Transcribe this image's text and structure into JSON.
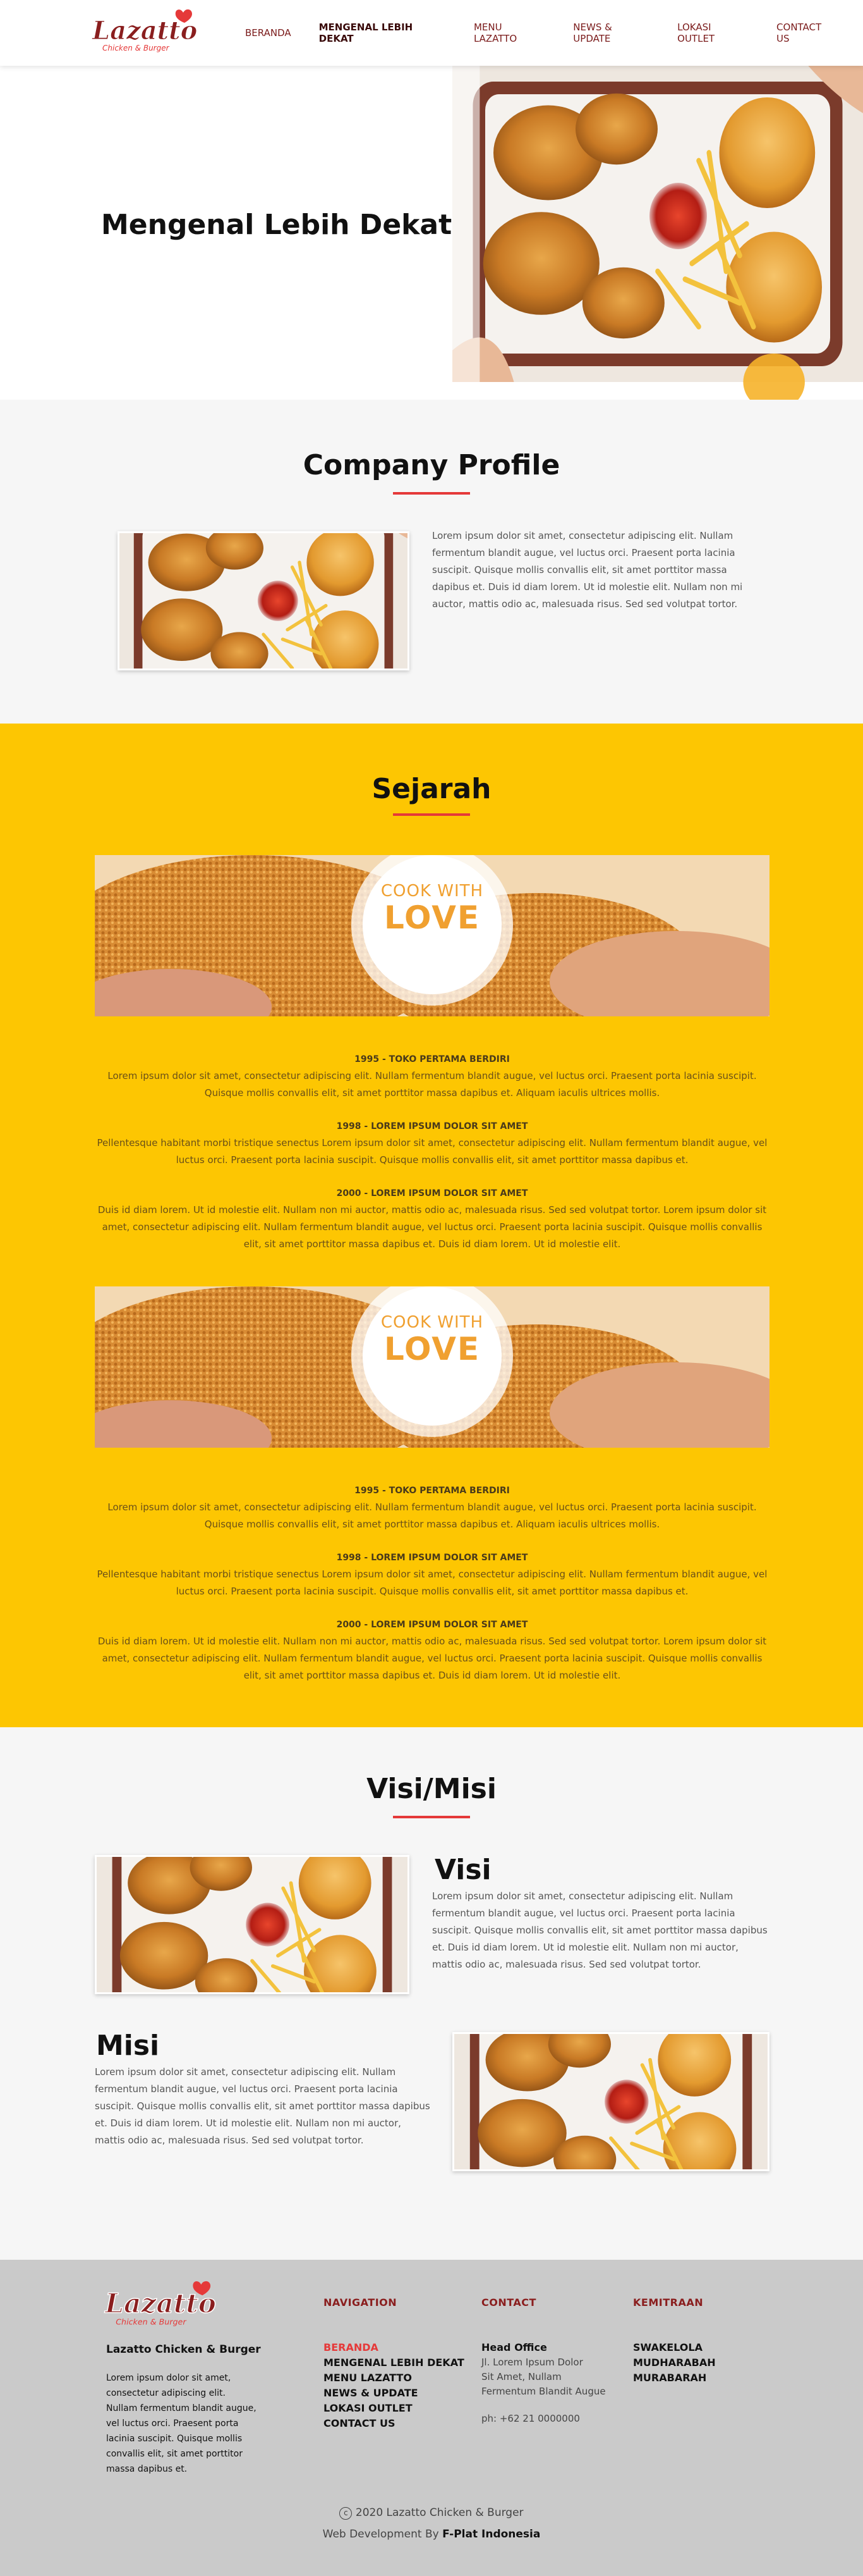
{
  "brand": {
    "logo_text": "Lazatto",
    "logo_sub": "Chicken & Burger"
  },
  "nav": {
    "items": [
      {
        "label": "BERANDA"
      },
      {
        "label": "MENGENAL LEBIH DEKAT"
      },
      {
        "label": "MENU LAZATTO"
      },
      {
        "label": "NEWS & UPDATE"
      },
      {
        "label": "LOKASI OUTLET"
      },
      {
        "label": "CONTACT US"
      }
    ]
  },
  "hero": {
    "title": "Mengenal Lebih Dekat"
  },
  "company_profile": {
    "title": "Company Profile",
    "text": "Lorem ipsum dolor sit amet, consectetur adipiscing elit. Nullam fermentum blandit augue, vel luctus orci. Praesent porta lacinia suscipit. Quisque mollis convallis elit, sit amet porttitor massa dapibus et. Duis id diam lorem. Ut id molestie elit. Nullam non mi auctor, mattis odio ac, malesuada risus. Sed sed volutpat tortor."
  },
  "sejarah": {
    "title": "Sejarah",
    "banner_top": "COOK WITH",
    "banner_big": "LOVE",
    "blocks": [
      {
        "items": [
          {
            "heading": "1995 - TOKO PERTAMA BERDIRI",
            "text": "Lorem ipsum dolor sit amet, consectetur adipiscing elit. Nullam fermentum blandit augue, vel luctus orci. Praesent porta lacinia suscipit. Quisque mollis convallis elit, sit amet porttitor massa dapibus et. Aliquam iaculis ultrices mollis."
          },
          {
            "heading": "1998 - LOREM IPSUM DOLOR SIT AMET",
            "text": "Pellentesque habitant morbi tristique senectus  Lorem ipsum dolor sit amet, consectetur adipiscing elit. Nullam fermentum blandit augue, vel luctus orci. Praesent porta lacinia suscipit. Quisque mollis convallis elit, sit amet porttitor massa dapibus et."
          },
          {
            "heading": "2000 - LOREM IPSUM DOLOR SIT AMET",
            "text": "Duis id diam lorem. Ut id molestie elit. Nullam non mi auctor, mattis odio ac, malesuada risus. Sed sed volutpat tortor. Lorem ipsum dolor sit amet, consectetur adipiscing elit. Nullam fermentum blandit augue, vel luctus orci. Praesent porta lacinia suscipit. Quisque mollis convallis elit, sit amet porttitor massa dapibus et. Duis id diam lorem. Ut id molestie elit."
          }
        ]
      },
      {
        "items": [
          {
            "heading": "1995 - TOKO PERTAMA BERDIRI",
            "text": "Lorem ipsum dolor sit amet, consectetur adipiscing elit. Nullam fermentum blandit augue, vel luctus orci. Praesent porta lacinia suscipit. Quisque mollis convallis elit, sit amet porttitor massa dapibus et. Aliquam iaculis ultrices mollis."
          },
          {
            "heading": "1998 - LOREM IPSUM DOLOR SIT AMET",
            "text": "Pellentesque habitant morbi tristique senectus  Lorem ipsum dolor sit amet, consectetur adipiscing elit. Nullam fermentum blandit augue, vel luctus orci. Praesent porta lacinia suscipit. Quisque mollis convallis elit, sit amet porttitor massa dapibus et."
          },
          {
            "heading": "2000 - LOREM IPSUM DOLOR SIT AMET",
            "text": "Duis id diam lorem. Ut id molestie elit. Nullam non mi auctor, mattis odio ac, malesuada risus. Sed sed volutpat tortor. Lorem ipsum dolor sit amet, consectetur adipiscing elit. Nullam fermentum blandit augue, vel luctus orci. Praesent porta lacinia suscipit. Quisque mollis convallis elit, sit amet porttitor massa dapibus et. Duis id diam lorem. Ut id molestie elit."
          }
        ]
      }
    ]
  },
  "visimisi": {
    "title": "Visi/Misi",
    "visi_title": "Visi",
    "visi_text": "Lorem ipsum dolor sit amet, consectetur adipiscing elit. Nullam fermentum blandit augue, vel luctus orci. Praesent porta lacinia suscipit. Quisque mollis convallis elit, sit amet porttitor massa dapibus et. Duis id diam lorem. Ut id molestie elit. Nullam non mi auctor, mattis odio ac, malesuada risus. Sed sed volutpat tortor.",
    "misi_title": "Misi",
    "misi_text": "Lorem ipsum dolor sit amet, consectetur adipiscing elit. Nullam fermentum blandit augue, vel luctus orci. Praesent porta lacinia suscipit. Quisque mollis convallis elit, sit amet porttitor massa dapibus et. Duis id diam lorem. Ut id molestie elit. Nullam non mi auctor, mattis odio ac, malesuada risus. Sed sed volutpat tortor."
  },
  "footer": {
    "name": "Lazatto Chicken & Burger",
    "desc": "Lorem ipsum dolor sit amet, consectetur adipiscing elit. Nullam fermentum blandit augue, vel luctus orci. Praesent porta lacinia suscipit. Quisque mollis convallis elit, sit amet porttitor massa dapibus et.",
    "nav_heading": "NAVIGATION",
    "nav_links": [
      "BERANDA",
      "MENGENAL LEBIH DEKAT",
      "MENU LAZATTO",
      "NEWS & UPDATE",
      "LOKASI OUTLET",
      "CONTACT US"
    ],
    "contact_heading": "CONTACT",
    "office_title": "Head Office",
    "office_address": [
      "Jl. Lorem Ipsum Dolor",
      "Sit Amet, Nullam",
      "Fermentum Blandit Augue"
    ],
    "phone": "ph: +62 21 0000000",
    "kemitraan_heading": "KEMITRAAN",
    "kemitraan_links": [
      "SWAKELOLA",
      "MUDHARABAH",
      "MURABARAH"
    ],
    "copyright": "2020 Lazatto Chicken & Burger",
    "dev_prefix": "Web Development By",
    "dev_name": "F-Plat Indonesia"
  },
  "colors": {
    "accent_red": "#e53939",
    "brand_yellow": "#fdc602",
    "nav_maroon": "#7a1a1a"
  }
}
